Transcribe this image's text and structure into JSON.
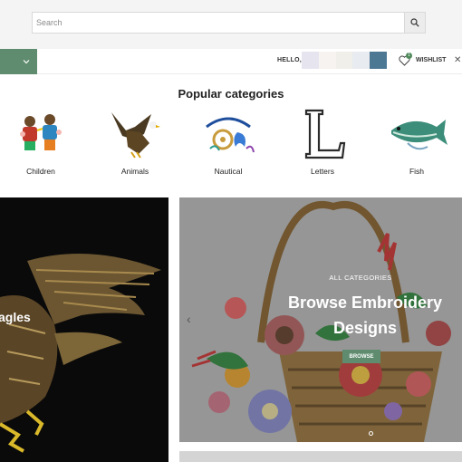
{
  "search": {
    "placeholder": "Search"
  },
  "nav": {
    "hello_label": "HELLO,",
    "wishlist_label": "WISHLIST",
    "wishlist_count": "1",
    "close_glyph": "✕"
  },
  "popular": {
    "title": "Popular categories",
    "items": [
      {
        "label": "Children"
      },
      {
        "label": "Animals"
      },
      {
        "label": "Nautical"
      },
      {
        "label": "Letters"
      },
      {
        "label": "Fish"
      }
    ]
  },
  "left_banner": {
    "text": "agles"
  },
  "hero": {
    "subtitle": "ALL CATEGORIES",
    "title": "Browse Embroidery Designs",
    "button_label": "BROWSE",
    "prev_glyph": "‹"
  },
  "colors": {
    "accent": "#5f8c6e",
    "badge": "#4f8a5b"
  }
}
